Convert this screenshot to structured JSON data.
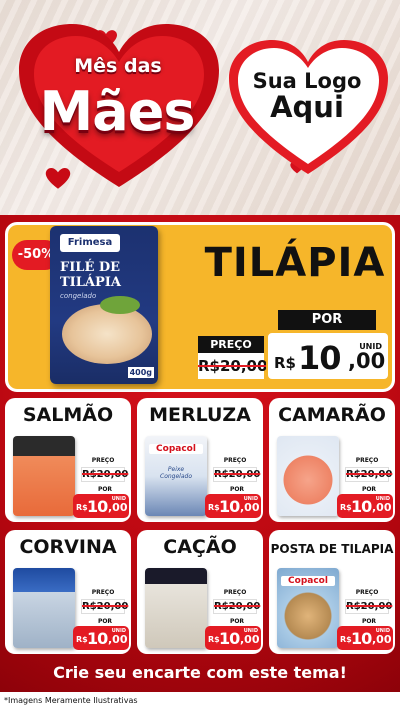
{
  "header": {
    "title_small": "Mês das",
    "title_big": "Mães",
    "logo_line1": "Sua Logo",
    "logo_line2": "Aqui"
  },
  "hero": {
    "badge": "-50%",
    "product_brand": "Frimesa",
    "product_name_line1": "FILÉ DE",
    "product_name_line2": "TILÁPIA",
    "product_sub": "congelado",
    "product_weight": "400g",
    "title": "TILÁPIA",
    "preco_label": "PREÇO",
    "old_price": "R$20,00",
    "por_label": "POR",
    "new_currency": "R$",
    "new_int": "10",
    "new_dec": ",00",
    "unid": "UNID"
  },
  "price_common": {
    "preco_label": "PREÇO",
    "old_price": "R$20,00",
    "por_label": "POR",
    "currency": "R$",
    "int": "10",
    "dec": ",00",
    "unid": "UNID"
  },
  "products": [
    {
      "name": "SALMÃO"
    },
    {
      "name": "MERLUZA",
      "brand": "Copacol",
      "pack_text": "Peixe Congelado"
    },
    {
      "name": "CAMARÃO"
    },
    {
      "name": "CORVINA"
    },
    {
      "name": "CAÇÃO"
    },
    {
      "name": "POSTA DE TILAPIA",
      "brand": "Copacol"
    }
  ],
  "cta": "Crie seu encarte com este tema!",
  "footnote": "*Imagens Meramente Ilustrativas",
  "colors": {
    "accent_red": "#e31b23",
    "yellow": "#f6b62a",
    "dark": "#111111"
  }
}
